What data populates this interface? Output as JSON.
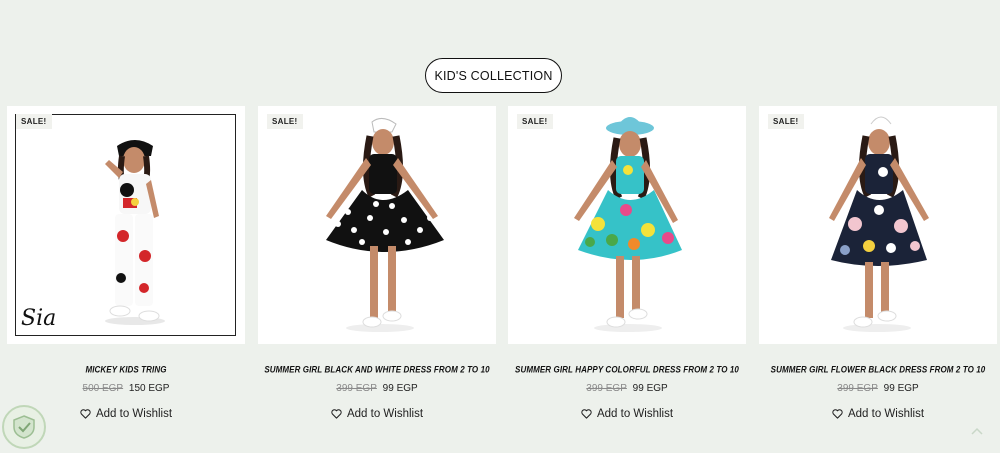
{
  "section": {
    "title": "KID'S COLLECTION"
  },
  "products": [
    {
      "badge": "SALE!",
      "name": "MICKEY KIDS TRING",
      "old_price": "500 EGP",
      "price": "150 EGP",
      "wishlist": "Add to Wishlist",
      "signature": "Sia",
      "dress_color": "#ffffff",
      "accent": "#d3262a"
    },
    {
      "badge": "SALE!",
      "name": "SUMMER GIRL BLACK AND WHITE DRESS FROM 2 TO 10",
      "old_price": "399 EGP",
      "price": "99 EGP",
      "wishlist": "Add to Wishlist",
      "dress_color": "#111111",
      "accent": "#ffffff"
    },
    {
      "badge": "SALE!",
      "name": "SUMMER GIRL HAPPY COLORFUL DRESS FROM 2 TO 10",
      "old_price": "399 EGP",
      "price": "99 EGP",
      "wishlist": "Add to Wishlist",
      "dress_color": "#36c2c8",
      "accent": "#f4e23a"
    },
    {
      "badge": "SALE!",
      "name": "SUMMER GIRL FLOWER BLACK DRESS FROM 2 TO 10",
      "old_price": "399 EGP",
      "price": "99 EGP",
      "wishlist": "Add to Wishlist",
      "dress_color": "#1b2338",
      "accent": "#f2c6cf"
    }
  ],
  "icons": {
    "wishlist": "heart-icon",
    "logo": "shield-check-logo-icon",
    "scroll": "chevron-up-icon"
  },
  "colors": {
    "background": "#edf1ec",
    "text": "#222222",
    "strike": "#8a8a8a"
  }
}
